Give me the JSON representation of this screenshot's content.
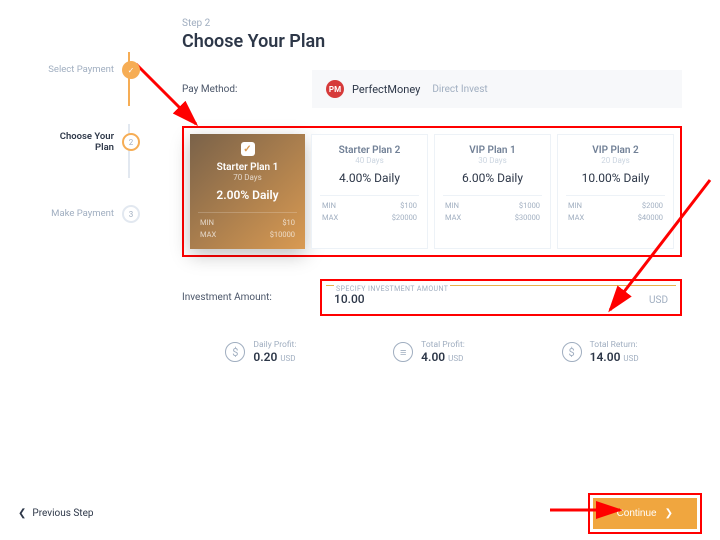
{
  "stepper": {
    "steps": [
      {
        "label": "Select Payment",
        "num": "✓",
        "state": "done"
      },
      {
        "label": "Choose Your Plan",
        "num": "2",
        "state": "active"
      },
      {
        "label": "Make Payment",
        "num": "3",
        "state": ""
      }
    ]
  },
  "header": {
    "caption": "Step 2",
    "title": "Choose Your Plan"
  },
  "pay_method": {
    "label": "Pay Method:",
    "logo_text": "PM",
    "name": "PerfectMoney",
    "mode": "Direct Invest"
  },
  "plans": [
    {
      "name": "Starter Plan 1",
      "days": "70 Days",
      "rate": "2.00% Daily",
      "min_label": "MIN",
      "min": "$10",
      "max_label": "MAX",
      "max": "$10000",
      "selected": true
    },
    {
      "name": "Starter Plan 2",
      "days": "40 Days",
      "rate": "4.00% Daily",
      "min_label": "MIN",
      "min": "$100",
      "max_label": "MAX",
      "max": "$20000",
      "selected": false
    },
    {
      "name": "VIP Plan 1",
      "days": "30 Days",
      "rate": "6.00% Daily",
      "min_label": "MIN",
      "min": "$1000",
      "max_label": "MAX",
      "max": "$30000",
      "selected": false
    },
    {
      "name": "VIP Plan 2",
      "days": "20 Days",
      "rate": "10.00% Daily",
      "min_label": "MIN",
      "min": "$2000",
      "max_label": "MAX",
      "max": "$40000",
      "selected": false
    }
  ],
  "amount": {
    "label": "Investment Amount:",
    "caption": "SPECIFY INVESTMENT AMOUNT",
    "value": "10.00",
    "currency": "USD"
  },
  "stats": {
    "daily": {
      "label": "Daily Profit:",
      "value": "0.20",
      "ccy": "USD"
    },
    "total": {
      "label": "Total Profit:",
      "value": "4.00",
      "ccy": "USD"
    },
    "return": {
      "label": "Total Return:",
      "value": "14.00",
      "ccy": "USD"
    }
  },
  "footer": {
    "prev": "Previous Step",
    "continue": "Continue"
  },
  "colors": {
    "accent": "#f0a63f",
    "annotation": "#ff0000"
  }
}
